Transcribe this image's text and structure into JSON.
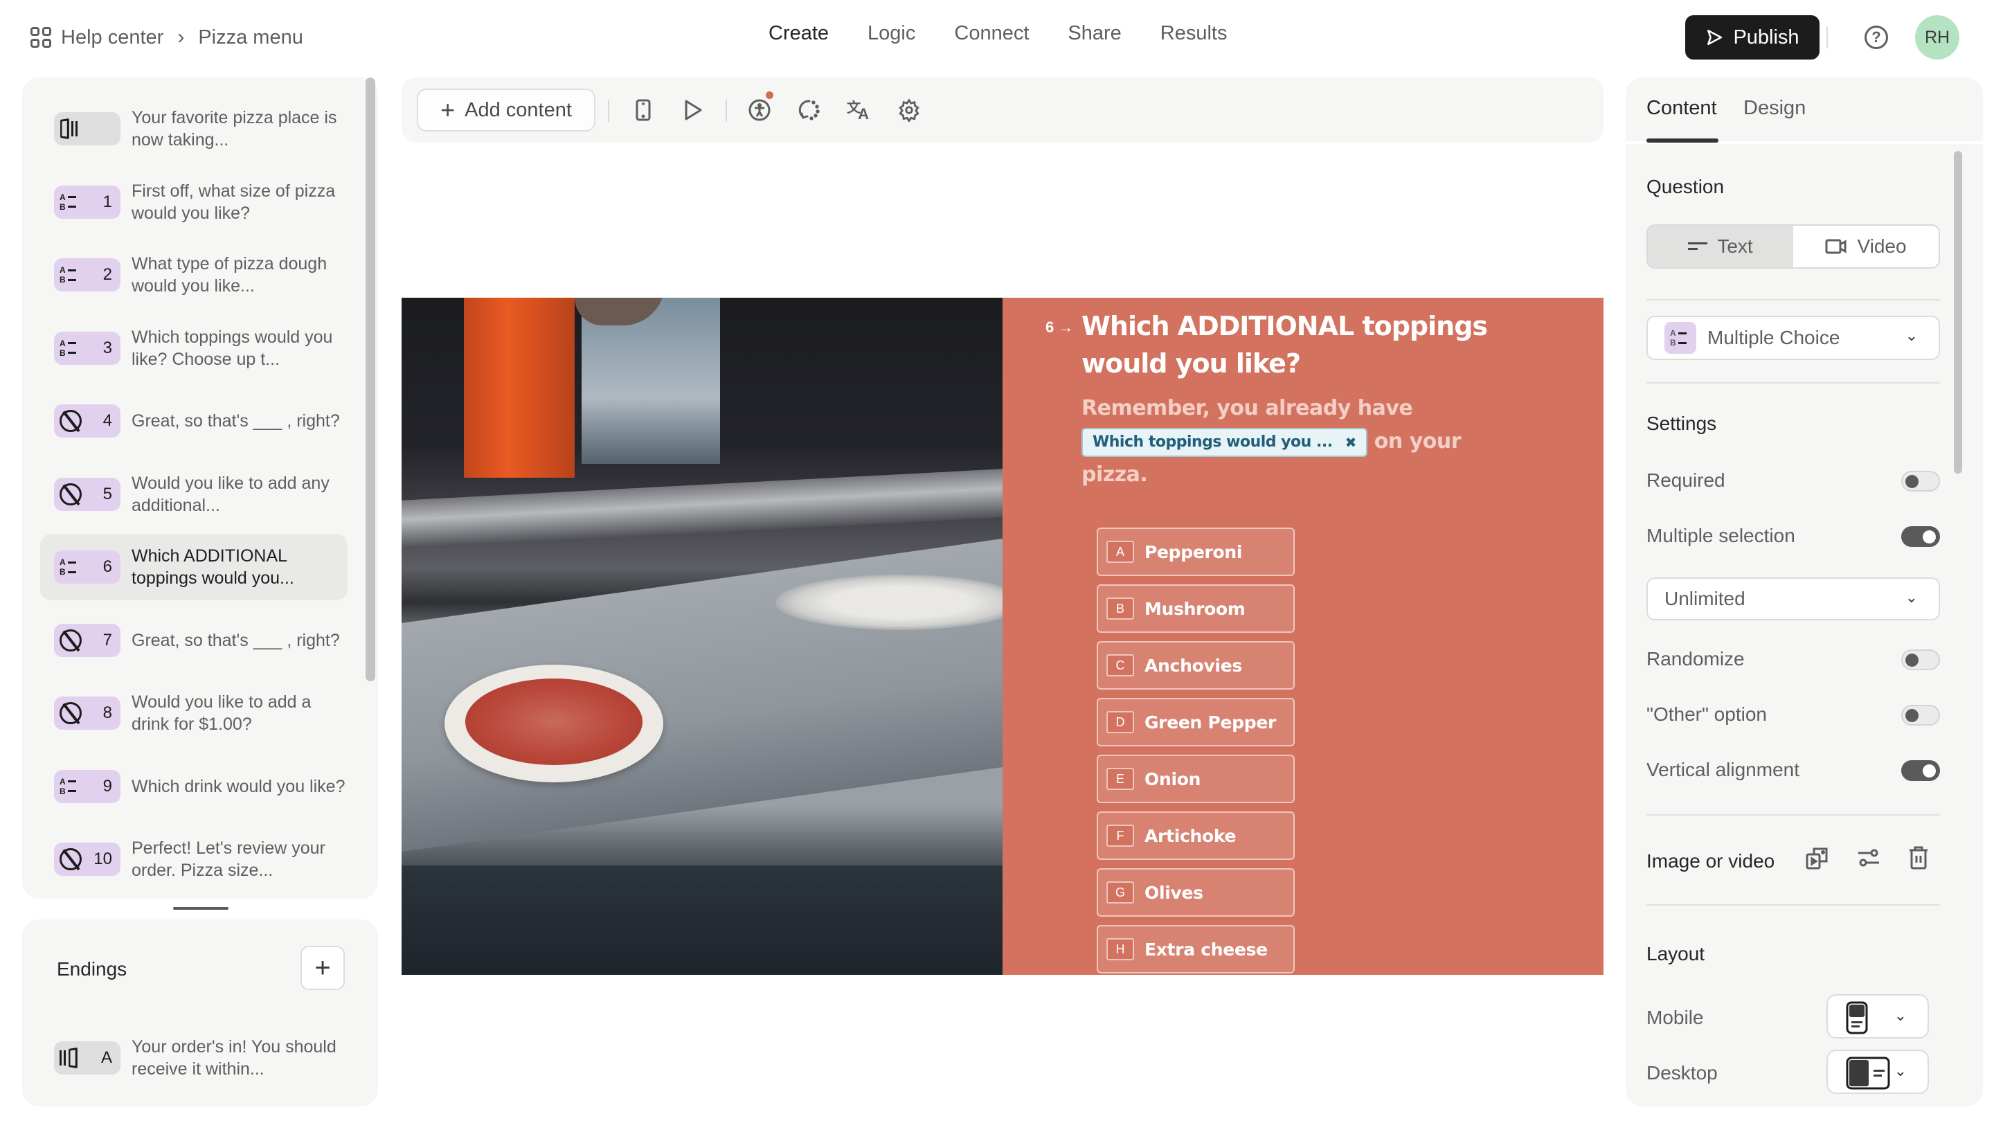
{
  "breadcrumb": {
    "icon": "grid-icon",
    "items": [
      "Help center",
      "Pizza menu"
    ],
    "separator": "›"
  },
  "nav": {
    "tabs": [
      {
        "label": "Create",
        "active": true
      },
      {
        "label": "Logic",
        "active": false
      },
      {
        "label": "Connect",
        "active": false
      },
      {
        "label": "Share",
        "active": false
      },
      {
        "label": "Results",
        "active": false
      }
    ]
  },
  "header_actions": {
    "publish_label": "Publish",
    "help_icon": "?",
    "avatar_initials": "RH",
    "avatar_color": "#b3e3c1"
  },
  "questions": [
    {
      "type": "statement",
      "number": "",
      "text": "Your favorite pizza place is now taking..."
    },
    {
      "type": "multiple-choice",
      "number": "1",
      "text": "First off, what size of pizza would you like?"
    },
    {
      "type": "multiple-choice",
      "number": "2",
      "text": "What type of pizza dough would you like..."
    },
    {
      "type": "multiple-choice",
      "number": "3",
      "text": "Which toppings would you like? Choose up t..."
    },
    {
      "type": "no-answer",
      "number": "4",
      "text": "Great, so that's ___ , right?"
    },
    {
      "type": "no-answer",
      "number": "5",
      "text": "Would you like to add any additional..."
    },
    {
      "type": "multiple-choice",
      "number": "6",
      "text": "Which ADDITIONAL toppings would you...",
      "selected": true
    },
    {
      "type": "no-answer",
      "number": "7",
      "text": "Great, so that's ___ , right?"
    },
    {
      "type": "no-answer",
      "number": "8",
      "text": "Would you like to add a drink for $1.00?"
    },
    {
      "type": "multiple-choice",
      "number": "9",
      "text": "Which drink would you like?"
    },
    {
      "type": "no-answer",
      "number": "10",
      "text": "Perfect! Let's review your order. Pizza size..."
    }
  ],
  "endings": {
    "title": "Endings",
    "add_label": "+",
    "items": [
      {
        "type": "ending",
        "letter": "A",
        "text": "Your order's in! You should receive it within..."
      }
    ]
  },
  "toolbar": {
    "add_content_label": "Add content",
    "icons": [
      "mobile-preview-icon",
      "play-icon",
      "accessibility-icon",
      "loading-icon",
      "translate-icon",
      "gear-icon"
    ],
    "notification_color": "#d56a56"
  },
  "question_card": {
    "number": "6",
    "arrow": "→",
    "title": "Which ADDITIONAL toppings would you like?",
    "description_before": "Remember, you already have",
    "recall_chip": "Which toppings would you ...",
    "recall_close": "✖",
    "description_after": "on your pizza.",
    "background_color": "#d3725f",
    "choices": [
      {
        "key": "A",
        "label": "Pepperoni"
      },
      {
        "key": "B",
        "label": "Mushroom"
      },
      {
        "key": "C",
        "label": "Anchovies"
      },
      {
        "key": "D",
        "label": "Green Pepper"
      },
      {
        "key": "E",
        "label": "Onion"
      },
      {
        "key": "F",
        "label": "Artichoke"
      },
      {
        "key": "G",
        "label": "Olives"
      },
      {
        "key": "H",
        "label": "Extra cheese"
      }
    ]
  },
  "right_panel": {
    "tabs": [
      {
        "label": "Content",
        "active": true
      },
      {
        "label": "Design",
        "active": false
      }
    ],
    "question_section": {
      "title": "Question",
      "modes": [
        {
          "label": "Text",
          "active": true
        },
        {
          "label": "Video",
          "active": false
        }
      ],
      "type_select": "Multiple Choice"
    },
    "settings": {
      "title": "Settings",
      "required": {
        "label": "Required",
        "on": false
      },
      "multiple_selection": {
        "label": "Multiple selection",
        "on": true
      },
      "selection_limit": "Unlimited",
      "randomize": {
        "label": "Randomize",
        "on": false
      },
      "other_option": {
        "label": "\"Other\" option",
        "on": false
      },
      "vertical_alignment": {
        "label": "Vertical alignment",
        "on": true
      }
    },
    "media": {
      "label": "Image or video"
    },
    "layout": {
      "title": "Layout",
      "mobile_label": "Mobile",
      "desktop_label": "Desktop"
    }
  }
}
